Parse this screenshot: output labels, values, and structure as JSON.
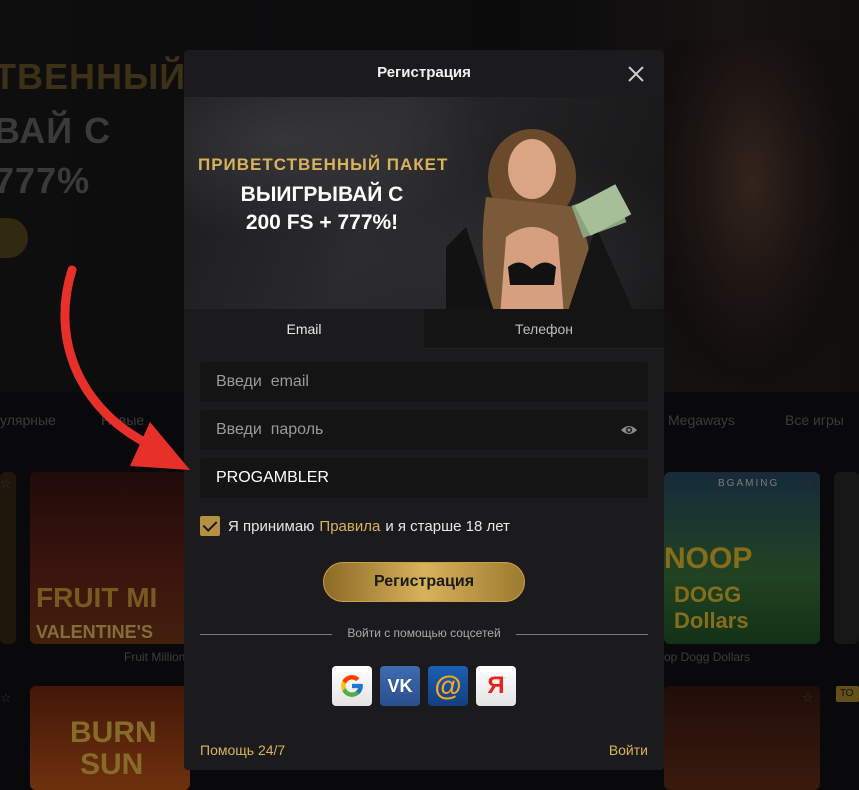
{
  "background": {
    "hero_lines": [
      "ТВЕННЫЙ",
      "ВАЙ С",
      "777%"
    ],
    "categories": [
      "улярные",
      "Новые",
      "Megaways",
      "Все игры"
    ],
    "tiles": [
      {
        "title": "FRUIT MI",
        "subtitle": "VALENTINE'S",
        "label": "Fruit Million"
      },
      {
        "title": "NOOP",
        "subtitle": "DOGG Dollars",
        "label": "op Dogg Dollars",
        "provider": "BGAMING"
      },
      {
        "title": "BURN",
        "subtitle": "SUN",
        "label": ""
      }
    ],
    "badge": "ТО"
  },
  "modal": {
    "title": "Регистрация",
    "banner": {
      "promo": "ПРИВЕТСТВЕННЫЙ ПАКЕТ",
      "line1": "ВЫИГРЫВАЙ С",
      "line2": "200 FS + 777%!"
    },
    "tabs": [
      {
        "label": "Email",
        "active": true
      },
      {
        "label": "Телефон",
        "active": false
      }
    ],
    "fields": {
      "email_placeholder": "Введи  email",
      "password_placeholder": "Введи  пароль",
      "promo_value": "PROGAMBLER"
    },
    "agree": {
      "checked": true,
      "text_before": "Я принимаю",
      "link": "Правила",
      "text_after": "и я старше 18 лет"
    },
    "register_button": "Регистрация",
    "social_label": "Войти с помощью соцсетей",
    "socials": [
      "google-icon",
      "vk-icon",
      "mail-ru-icon",
      "yandex-icon"
    ],
    "social_glyphs": {
      "vk": "VK",
      "mail": "@",
      "yandex": "Я"
    },
    "footer": {
      "help": "Помощь 24/7",
      "login": "Войти"
    }
  },
  "colors": {
    "accent_gold": "#d8b25d",
    "modal_bg": "#1b1b1d",
    "field_bg": "#141415",
    "annotation_arrow": "#e8302a"
  }
}
